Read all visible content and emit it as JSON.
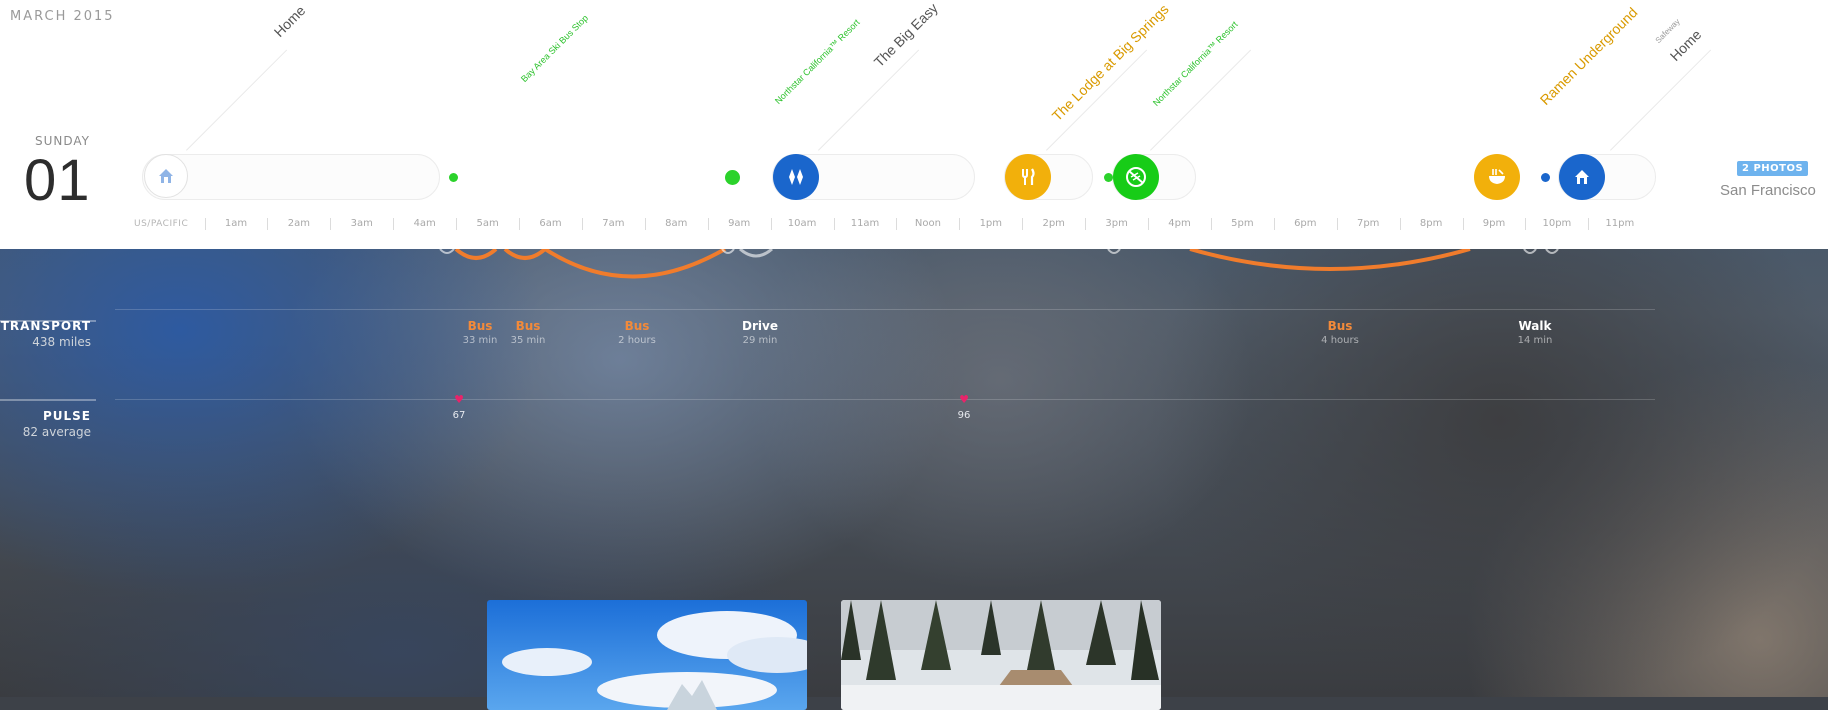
{
  "date": {
    "month_year": "MARCH 2015",
    "weekday": "SUNDAY",
    "day": "01"
  },
  "places": [
    {
      "name": "Home",
      "color": "#555555"
    },
    {
      "name": "Bay Area Ski Bus Stop",
      "color": "#2cc22c"
    },
    {
      "name": "Northstar California™ Resort",
      "color": "#2cc22c"
    },
    {
      "name": "The Big Easy",
      "color": "#555555"
    },
    {
      "name": "The Lodge at Big Springs",
      "color": "#d99a00"
    },
    {
      "name": "Northstar California™ Resort",
      "color": "#2cc22c"
    },
    {
      "name": "Ramen Underground",
      "color": "#d99a00"
    },
    {
      "name": "Safeway",
      "color": "#9a9a9a"
    },
    {
      "name": "Home",
      "color": "#555555"
    }
  ],
  "pins": [
    {
      "icon": "home-icon",
      "color": "#ffffff",
      "icon_color": "#8fb4e6"
    },
    {
      "icon": "ski-lift-icon",
      "color": "#1a66cc"
    },
    {
      "icon": "fork-knife-icon",
      "color": "#f2b00b"
    },
    {
      "icon": "no-skiing-icon",
      "color": "#17cc17"
    },
    {
      "icon": "ramen-icon",
      "color": "#f2b00b"
    },
    {
      "icon": "home-icon",
      "color": "#1a66cc"
    }
  ],
  "timeline": {
    "timezone": "US/PACIFIC",
    "hours": [
      "1am",
      "2am",
      "3am",
      "4am",
      "5am",
      "6am",
      "7am",
      "8am",
      "9am",
      "10am",
      "11am",
      "Noon",
      "1pm",
      "2pm",
      "3pm",
      "4pm",
      "5pm",
      "6pm",
      "7pm",
      "8pm",
      "9pm",
      "10pm",
      "11pm"
    ]
  },
  "photos_badge": "2 PHOTOS",
  "location": "San Francisco",
  "transport": {
    "title": "TRANSPORT",
    "summary": "438 miles",
    "mode_colors": {
      "Bus": "#f28a3a",
      "Drive": "#ffffff",
      "Walk": "#ffffff"
    },
    "trips": [
      {
        "mode": "Bus",
        "duration": "33 min"
      },
      {
        "mode": "Bus",
        "duration": "35 min"
      },
      {
        "mode": "Bus",
        "duration": "2 hours"
      },
      {
        "mode": "Drive",
        "duration": "29 min"
      },
      {
        "mode": "Bus",
        "duration": "4 hours"
      },
      {
        "mode": "Walk",
        "duration": "14 min"
      }
    ]
  },
  "pulse": {
    "title": "PULSE",
    "summary": "82 average",
    "readings": [
      {
        "value": "67"
      },
      {
        "value": "96"
      }
    ]
  },
  "colors": {
    "accent_orange": "#f28a3a",
    "heart_pink": "#e8246a",
    "badge_blue": "#6eb3ee"
  }
}
